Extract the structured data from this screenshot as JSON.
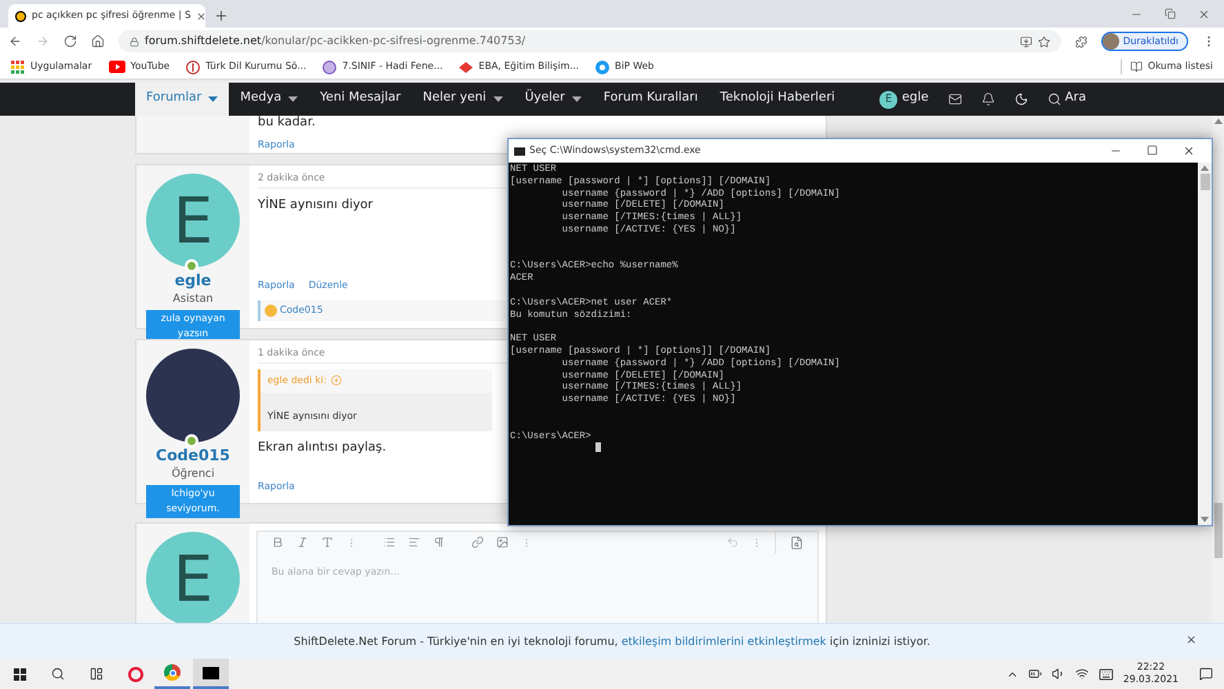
{
  "browser": {
    "tab_title": "pc açıkken pc şifresi öğrenme | S",
    "url_domain": "forum.shiftdelete.net",
    "url_path": "/konular/pc-acikken-pc-sifresi-ogrenme.740753/",
    "profile_label": "Duraklatıldı",
    "bookmarks": [
      {
        "label": "Uygulamalar",
        "kind": "apps"
      },
      {
        "label": "YouTube",
        "kind": "youtube"
      },
      {
        "label": "Türk Dil Kurumu Sö...",
        "kind": "tdk"
      },
      {
        "label": "7.SINIF - Hadi Fene...",
        "kind": "globe"
      },
      {
        "label": "EBA, Eğitim Bilişim...",
        "kind": "eba"
      },
      {
        "label": "BiP Web",
        "kind": "bip"
      }
    ],
    "reading_list": "Okuma listesi"
  },
  "nav": {
    "items": [
      {
        "label": "Forumlar",
        "selected": true,
        "has_menu": true
      },
      {
        "label": "Medya",
        "selected": false,
        "has_menu": true
      },
      {
        "label": "Yeni Mesajlar",
        "selected": false,
        "has_menu": false
      },
      {
        "label": "Neler yeni",
        "selected": false,
        "has_menu": true
      },
      {
        "label": "Üyeler",
        "selected": false,
        "has_menu": true
      },
      {
        "label": "Forum Kuralları",
        "selected": false,
        "has_menu": false
      },
      {
        "label": "Teknoloji Haberleri",
        "selected": false,
        "has_menu": false
      }
    ],
    "user": {
      "initial": "E",
      "name": "egle"
    },
    "search": "Ara"
  },
  "top_post": {
    "body": "bu kadar.",
    "actions": [
      "Raporla"
    ]
  },
  "posts": [
    {
      "avatar": {
        "kind": "letter",
        "initial": "E"
      },
      "author": "egle",
      "role": "Asistan",
      "banner": "zula oynayan yazsın",
      "time": "2 dakika önce",
      "body": "YİNE aynısını diyor",
      "actions": [
        "Raporla",
        "Düzenle"
      ],
      "reaction": {
        "name": "Code015"
      }
    },
    {
      "avatar": {
        "kind": "image"
      },
      "author": "Code015",
      "role": "Öğrenci",
      "banner": "Ichigo'yu seviyorum.",
      "time": "1 dakika önce",
      "quote": {
        "author": "egle dedi ki:",
        "text": "YİNE aynısını diyor"
      },
      "body": "Ekran alıntısı paylaş.",
      "actions": [
        "Raporla"
      ]
    }
  ],
  "editor": {
    "avatar_initial": "E",
    "placeholder": "Bu alana bir cevap yazın..."
  },
  "cmd": {
    "title": "Seç C:\\Windows\\system32\\cmd.exe",
    "sections": [
      {
        "blocks": [
          {
            "lines": [
              "NET USER",
              "[username [password | *] [options]] [/DOMAIN]",
              "         username {password | *} /ADD [options] [/DOMAIN]",
              "         username [/DELETE] [/DOMAIN]",
              "         username [/TIMES:{times | ALL}]",
              "         username [/ACTIVE: {YES | NO}]"
            ]
          }
        ]
      },
      {
        "blocks": [
          {
            "lines": [
              "C:\\Users\\ACER>echo %username%",
              "ACER"
            ]
          },
          {
            "lines": [
              "C:\\Users\\ACER>net user ACER*",
              "Bu komutun sözdizimi:"
            ]
          },
          {
            "lines": [
              "NET USER",
              "[username [password | *] [options]] [/DOMAIN]",
              "         username {password | *} /ADD [options] [/DOMAIN]",
              "         username [/DELETE] [/DOMAIN]",
              "         username [/TIMES:{times | ALL}]",
              "         username [/ACTIVE: {YES | NO}]"
            ]
          }
        ]
      },
      {
        "blocks": [
          {
            "lines": [
              "C:\\Users\\ACER>"
            ]
          }
        ]
      }
    ]
  },
  "notification": {
    "before": "ShiftDelete.Net Forum - Türkiye'nin en iyi teknoloji forumu,",
    "link": "etkileşim bildirimlerini etkinleştirmek",
    "after": "için izninizi istiyor.",
    "close": "×"
  },
  "taskbar": {
    "time": "22:22",
    "date": "29.03.2021"
  }
}
